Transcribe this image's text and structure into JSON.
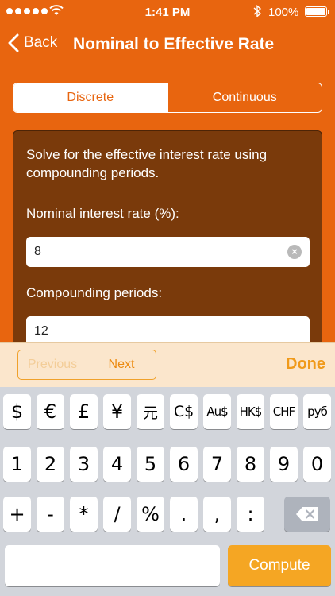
{
  "status_bar": {
    "time": "1:41 PM",
    "battery": "100%"
  },
  "nav": {
    "back_label": "Back",
    "title": "Nominal to Effective Rate"
  },
  "segments": [
    "Discrete",
    "Continuous"
  ],
  "form": {
    "description": "Solve for the effective interest rate using compounding periods.",
    "nominal_label": "Nominal interest rate (%):",
    "nominal_value": "8",
    "periods_label": "Compounding periods:",
    "periods_value": "12"
  },
  "accessory": {
    "previous": "Previous",
    "next": "Next",
    "done": "Done"
  },
  "keyboard": {
    "currency_row": [
      "$",
      "€",
      "£",
      "¥",
      "元",
      "C$",
      "Au$",
      "HK$",
      "CHF",
      "руб"
    ],
    "digit_row": [
      "1",
      "2",
      "3",
      "4",
      "5",
      "6",
      "7",
      "8",
      "9",
      "0"
    ],
    "symbol_row": [
      "+",
      "-",
      "*",
      "/",
      "%",
      ".",
      ",",
      ":"
    ],
    "compute": "Compute"
  },
  "colors": {
    "accent": "#e8650f",
    "panel": "#7a3a0b",
    "compute": "#f5a623"
  }
}
